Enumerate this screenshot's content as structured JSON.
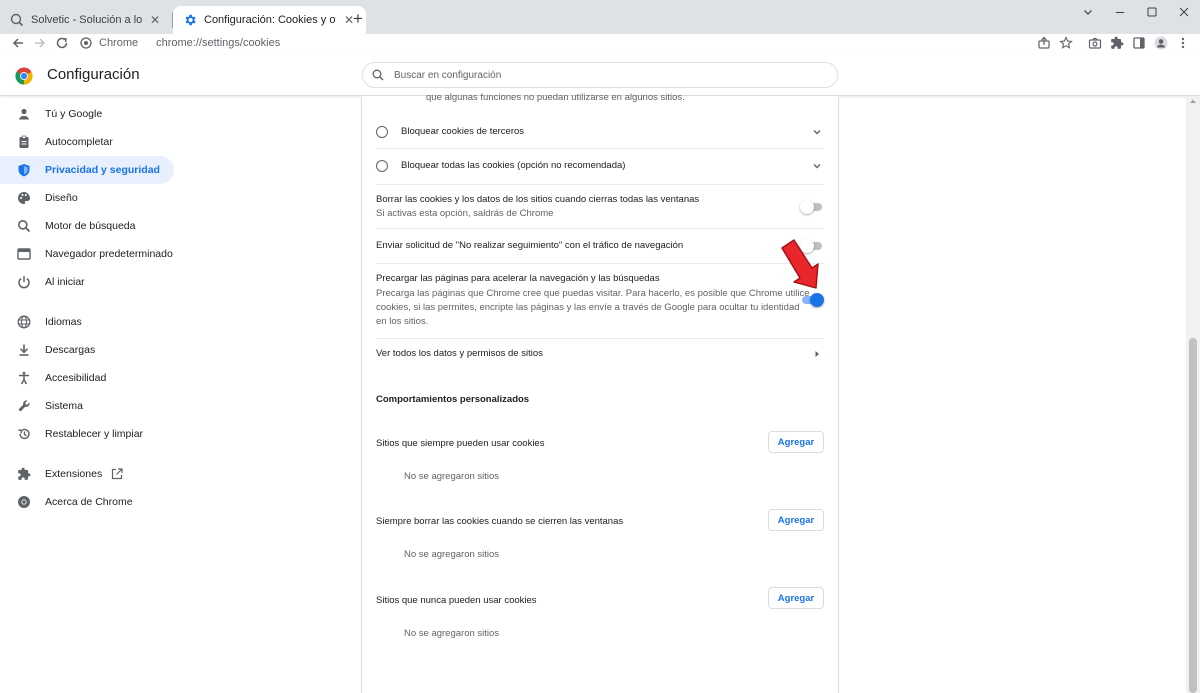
{
  "browser": {
    "tabs": [
      {
        "title": "Solvetic - Solución a los problemas",
        "close": "✕"
      },
      {
        "title": "Configuración: Cookies y otros datos",
        "close": "✕"
      }
    ],
    "new_tab": "+",
    "omnibox": {
      "site_label": "Chrome",
      "url": "chrome://settings/cookies"
    }
  },
  "settings": {
    "title": "Configuración",
    "search_placeholder": "Buscar en configuración"
  },
  "sidebar": {
    "items": [
      {
        "label": "Tú y Google",
        "icon": "person-icon"
      },
      {
        "label": "Autocompletar",
        "icon": "clipboard-icon"
      },
      {
        "label": "Privacidad y seguridad",
        "icon": "shield-icon",
        "selected": true
      },
      {
        "label": "Diseño",
        "icon": "palette-icon"
      },
      {
        "label": "Motor de búsqueda",
        "icon": "search-icon"
      },
      {
        "label": "Navegador predeterminado",
        "icon": "browser-icon"
      },
      {
        "label": "Al iniciar",
        "icon": "power-icon"
      },
      {
        "label": "Idiomas",
        "icon": "globe-icon"
      },
      {
        "label": "Descargas",
        "icon": "download-icon"
      },
      {
        "label": "Accesibilidad",
        "icon": "accessibility-icon"
      },
      {
        "label": "Sistema",
        "icon": "wrench-icon"
      },
      {
        "label": "Restablecer y limpiar",
        "icon": "restore-icon"
      },
      {
        "label": "Extensiones",
        "icon": "puzzle-icon"
      },
      {
        "label": "Acerca de Chrome",
        "icon": "chrome-icon"
      }
    ]
  },
  "main": {
    "top_partial": "que algunas funciones no puedan utilizarse en algunos sitios.",
    "radio_block_third_party": "Bloquear cookies de terceros",
    "radio_block_all": "Bloquear todas las cookies (opción no recomendada)",
    "clear_on_exit": {
      "title": "Borrar las cookies y los datos de los sitios cuando cierras todas las ventanas",
      "subtitle": "Si activas esta opción, saldrás de Chrome",
      "enabled": false
    },
    "do_not_track": {
      "title": "Enviar solicitud de \"No realizar seguimiento\" con el tráfico de navegación",
      "enabled": false
    },
    "preload": {
      "title": "Precargar las páginas para acelerar la navegación y las búsquedas",
      "subtitle_1": "Precarga las páginas que Chrome cree que puedas visitar. Para hacerlo, es posible que Chrome utilice",
      "subtitle_2": "cookies, si las permites, encripte las páginas y las envíe a través de Google para ocultar tu identidad",
      "subtitle_3": "en los sitios.",
      "enabled": true
    },
    "see_all": "Ver todos los datos y permisos de sitios",
    "custom_title": "Comportamientos personalizados",
    "always_allow": {
      "label": "Sitios que siempre pueden usar cookies",
      "button": "Agregar",
      "empty": "No se agregaron sitios"
    },
    "always_clear": {
      "label": "Siempre borrar las cookies cuando se cierren las ventanas",
      "button": "Agregar",
      "empty": "No se agregaron sitios"
    },
    "never_allow": {
      "label": "Sitios que nunca pueden usar cookies",
      "button": "Agregar",
      "empty": "No se agregaron sitios"
    }
  },
  "colors": {
    "accent": "#1a73e8",
    "selected_bg": "#e8f0fe",
    "arrow": "#e8262c"
  }
}
